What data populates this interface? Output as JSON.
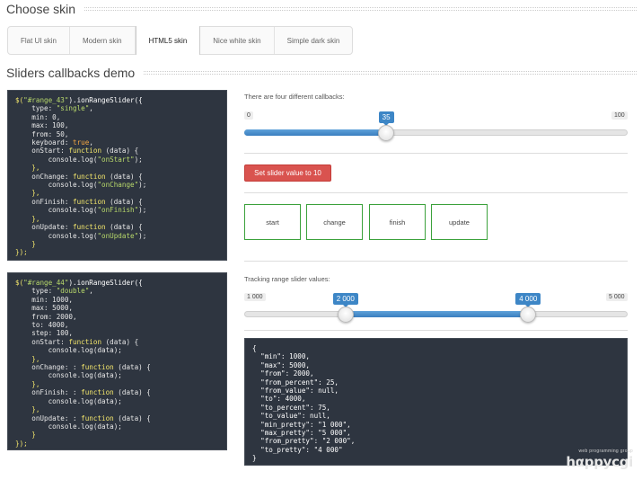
{
  "headings": {
    "choose_skin": "Choose skin",
    "callbacks_demo": "Sliders callbacks demo"
  },
  "skins": [
    "Flat UI skin",
    "Modern skin",
    "HTML5 skin",
    "Nice white skin",
    "Simple dark skin"
  ],
  "active_skin": "HTML5 skin",
  "code1": {
    "l1a": "$(",
    "l1b": "\"#range_43\"",
    "l1c": ").ionRangeSlider({",
    "l2a": "    type: ",
    "l2b": "\"single\"",
    "l2c": ",",
    "l3": "    min: 0,",
    "l4": "    max: 100,",
    "l5": "    from: 50,",
    "l6a": "    keyboard: ",
    "l6b": "true",
    "l6c": ",",
    "l7a": "    onStart: ",
    "l7b": "function",
    "l7c": " (data) {",
    "l8a": "        console.log(",
    "l8b": "\"onStart\"",
    "l8c": ");",
    "l9": "    },",
    "l10a": "    onChange: ",
    "l10b": "function",
    "l10c": " (data) {",
    "l11a": "        console.log(",
    "l11b": "\"onChange\"",
    "l11c": ");",
    "l12": "    },",
    "l13a": "    onFinish: ",
    "l13b": "function",
    "l13c": " (data) {",
    "l14a": "        console.log(",
    "l14b": "\"onFinish\"",
    "l14c": ");",
    "l15": "    },",
    "l16a": "    onUpdate: ",
    "l16b": "function",
    "l16c": " (data) {",
    "l17a": "        console.log(",
    "l17b": "\"onUpdate\"",
    "l17c": ");",
    "l18": "    }",
    "l19": "});"
  },
  "code2": {
    "l1a": "$(",
    "l1b": "\"#range_44\"",
    "l1c": ").ionRangeSlider({",
    "l2a": "    type: ",
    "l2b": "\"double\"",
    "l2c": ",",
    "l3": "    min: 1000,",
    "l4": "    max: 5000,",
    "l5": "    from: 2000,",
    "l6": "    to: 4000,",
    "l7": "    step: 100,",
    "l8a": "    onStart: ",
    "l8b": "function",
    "l8c": " (data) {",
    "l9": "        console.log(data);",
    "l10": "    },",
    "l11a": "    onChange: : ",
    "l11b": "function",
    "l11c": " (data) {",
    "l12": "        console.log(data);",
    "l13": "    },",
    "l14a": "    onFinish: : ",
    "l14b": "function",
    "l14c": " (data) {",
    "l15": "        console.log(data);",
    "l16": "    },",
    "l17a": "    onUpdate: : ",
    "l17b": "function",
    "l17c": " (data) {",
    "l18": "        console.log(data);",
    "l19": "    }",
    "l20": "});"
  },
  "slider1": {
    "caption": "There are four different callbacks:",
    "min_label": "0",
    "max_label": "100",
    "value_label": "35",
    "value_fraction": 0.35
  },
  "set_button_label": "Set slider value to 10",
  "callbacks": [
    "start",
    "change",
    "finish",
    "update"
  ],
  "slider2": {
    "caption": "Tracking range slider values:",
    "min_label": "1 000",
    "max_label": "5 000",
    "from_label": "2 000",
    "to_label": "4 000",
    "from_fraction": 0.25,
    "to_fraction": 0.75
  },
  "json_output": {
    "l1": "{",
    "l2": "  \"min\": 1000,",
    "l3": "  \"max\": 5000,",
    "l4": "  \"from\": 2000,",
    "l5": "  \"from_percent\": 25,",
    "l6": "  \"from_value\": null,",
    "l7": "  \"to\": 4000,",
    "l8": "  \"to_percent\": 75,",
    "l9": "  \"to_value\": null,",
    "l10": "  \"min_pretty\": \"1 000\",",
    "l11": "  \"max_pretty\": \"5 000\",",
    "l12": "  \"from_pretty\": \"2 000\",",
    "l13": "  \"to_pretty\": \"4 000\"",
    "l14": "}"
  },
  "logo": {
    "tagline": "web programming group",
    "name": "hαppycgi"
  }
}
